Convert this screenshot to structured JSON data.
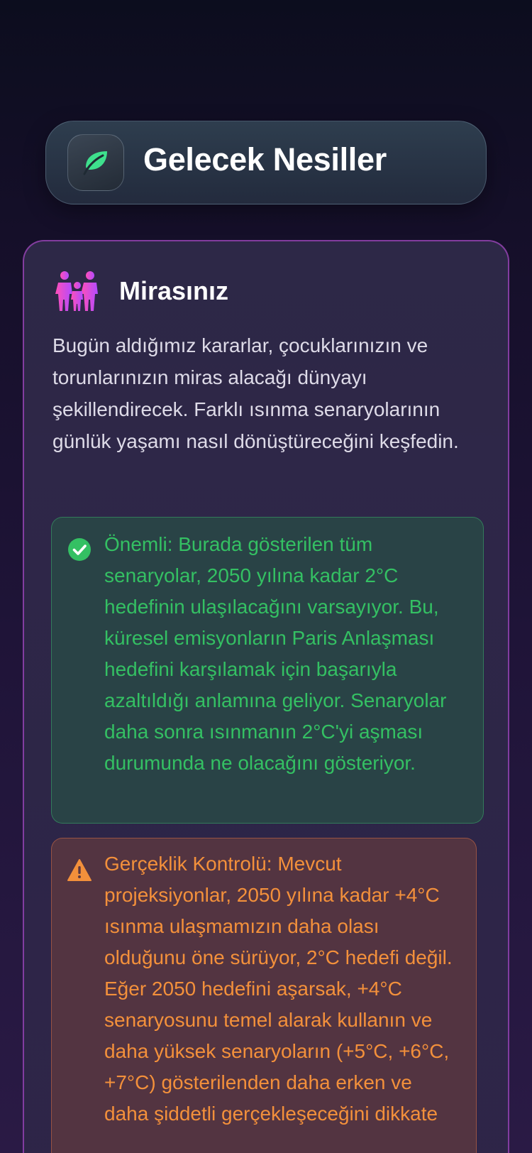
{
  "header": {
    "icon": "leaf-icon",
    "title": "Gelecek Nesiller"
  },
  "section": {
    "icon": "family-icon",
    "title": "Mirasınız",
    "intro": "Bugün aldığımız kararlar, çocuklarınızın ve torunlarınızın miras alacağı dünyayı şekillendirecek. Farklı ısınma senaryolarının günlük yaşamı nasıl dönüştüreceğini keşfedin."
  },
  "notices": {
    "important": {
      "icon": "check-circle-icon",
      "color": "#34c063",
      "text": "Önemli: Burada gösterilen tüm senaryolar, 2050 yılına kadar 2°C hedefinin ulaşılacağını varsayıyor. Bu, küresel emisyonların Paris Anlaşması hedefini karşılamak için başarıyla azaltıldığı anlamına geliyor. Senaryolar daha sonra ısınmanın 2°C'yi aşması durumunda ne olacağını gösteriyor."
    },
    "reality": {
      "icon": "warning-triangle-icon",
      "color": "#f3903b",
      "text": "Gerçeklik Kontrolü: Mevcut projeksiyonlar, 2050 yılına kadar +4°C ısınma ulaşmamızın daha olası olduğunu öne sürüyor, 2°C hedefi değil. Eğer 2050 hedefini aşarsak, +4°C senaryosunu temel alarak kullanın ve daha yüksek senaryoların (+5°C, +6°C, +7°C) gösterilenden daha erken ve daha şiddetli gerçekleşeceğini dikkate"
    }
  },
  "colors": {
    "accent_green": "#34c063",
    "accent_orange": "#f3903b",
    "card_border": "#a046be"
  }
}
